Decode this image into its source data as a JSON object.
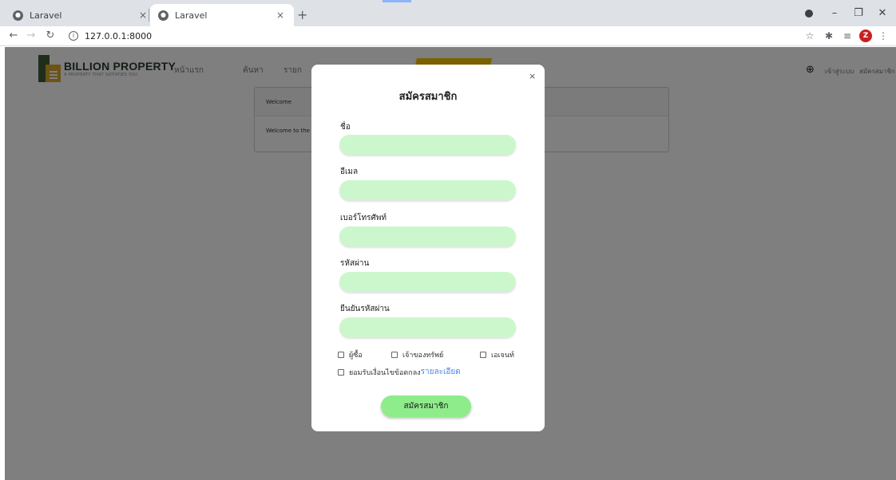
{
  "browser": {
    "tabs": [
      {
        "title": "Laravel"
      },
      {
        "title": "Laravel"
      }
    ],
    "url": "127.0.0.1:8000"
  },
  "site": {
    "brand": "BILLION PROPERTY",
    "tagline": "A PROPERTY THAT SATISFIES YOU",
    "nav": [
      "หน้าแรก",
      "ค้นหา",
      "รายก"
    ],
    "nav_right": [
      "เข้าสู่ระบบ",
      "สมัครสมาชิก"
    ],
    "card": {
      "heading": "Welcome",
      "body": "Welcome to the"
    }
  },
  "modal": {
    "close": "×",
    "title": "สมัครสมาชิก",
    "fields": [
      {
        "label": "ชื่อ",
        "value": ""
      },
      {
        "label": "อีเมล",
        "value": ""
      },
      {
        "label": "เบอร์โทรศัพท์",
        "value": ""
      },
      {
        "label": "รหัสผ่าน",
        "value": ""
      },
      {
        "label": "ยืนยันรหัสผ่าน",
        "value": ""
      }
    ],
    "roles": [
      "ผู้ซื้อ",
      "เจ้าของทรัพย์",
      "เอเจนท์"
    ],
    "terms_label": "ยอมรับเงื่อนไขข้อตกลง",
    "terms_link": "รายละเอียด",
    "submit": "สมัครสมาชิก"
  }
}
